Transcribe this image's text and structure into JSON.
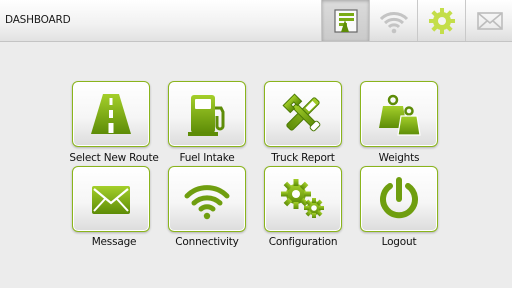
{
  "header": {
    "title": "DASHBOARD",
    "buttons": [
      {
        "icon": "route-map-icon",
        "active": true
      },
      {
        "icon": "wifi-icon"
      },
      {
        "icon": "gear-icon"
      },
      {
        "icon": "envelope-icon"
      }
    ]
  },
  "tiles": [
    {
      "label": "Select New Route",
      "icon": "road-icon"
    },
    {
      "label": "Fuel Intake",
      "icon": "fuel-pump-icon"
    },
    {
      "label": "Truck Report",
      "icon": "tools-icon"
    },
    {
      "label": "Weights",
      "icon": "weights-icon"
    },
    {
      "label": "Message",
      "icon": "envelope-icon"
    },
    {
      "label": "Connectivity",
      "icon": "wifi-icon"
    },
    {
      "label": "Configuration",
      "icon": "gears-icon"
    },
    {
      "label": "Logout",
      "icon": "power-icon"
    }
  ],
  "colors": {
    "accent": "#7aab14",
    "accent_dark": "#4c7a05",
    "background": "#ececec"
  }
}
